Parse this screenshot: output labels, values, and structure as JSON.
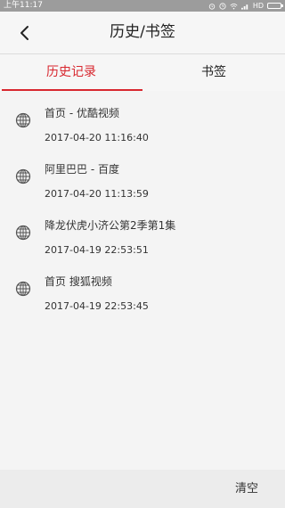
{
  "status_bar": {
    "time": "上午11:17",
    "network": "HD"
  },
  "header": {
    "title": "历史/书签",
    "back_icon": "chevron-left-icon"
  },
  "tabs": [
    {
      "label": "历史记录",
      "active": true
    },
    {
      "label": "书签",
      "active": false
    }
  ],
  "history": [
    {
      "title": "首页 - 优酷视频",
      "time": "2017-04-20 11:16:40",
      "icon": "globe-icon"
    },
    {
      "title": "阿里巴巴 - 百度",
      "time": "2017-04-20 11:13:59",
      "icon": "globe-icon"
    },
    {
      "title": "降龙伏虎小济公第2季第1集",
      "time": "2017-04-19 22:53:51",
      "icon": "globe-icon"
    },
    {
      "title": "首页 搜狐视频",
      "time": "2017-04-19 22:53:45",
      "icon": "globe-icon"
    }
  ],
  "footer": {
    "clear_label": "清空"
  },
  "colors": {
    "accent": "#d8272f",
    "background": "#f4f4f4"
  }
}
